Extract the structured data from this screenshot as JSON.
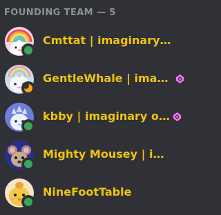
{
  "section": {
    "title": "FOUNDING TEAM — 5"
  },
  "colors": {
    "background": "#2f3136",
    "header_text": "#8e9297",
    "role_color": "#f1c40f",
    "status_online": "#3ba55d",
    "status_idle": "#faa61a",
    "boost": "#ff73fa"
  },
  "members": [
    {
      "name": "Cmttat | imaginary ones",
      "status": "online",
      "boosting": false,
      "avatar": "rainbow-bear-avatar"
    },
    {
      "name": "GentleWhale | imaginary ones",
      "status": "idle",
      "boosting": true,
      "avatar": "rainbow-unicorn-avatar"
    },
    {
      "name": "kbby | imaginary ones",
      "status": "online",
      "boosting": true,
      "avatar": "crystal-creature-avatar"
    },
    {
      "name": "Mighty Mousey | imaginary ones",
      "status": "online",
      "boosting": false,
      "avatar": "mouse-avatar"
    },
    {
      "name": "NineFootTable",
      "status": "online",
      "boosting": false,
      "avatar": "yellow-bird-avatar"
    }
  ]
}
